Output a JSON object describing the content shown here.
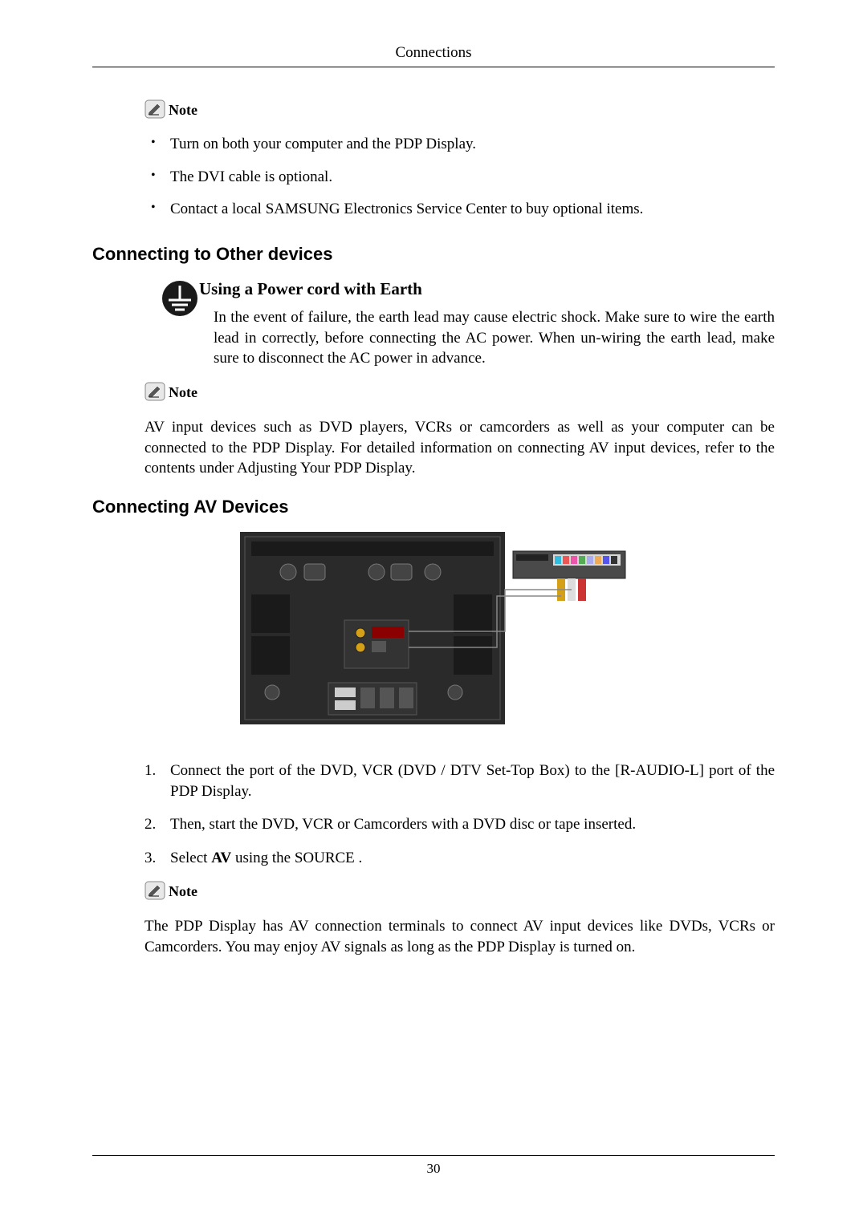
{
  "header": "Connections",
  "note_label": "Note",
  "bullets_1": [
    "Turn on both your computer and the PDP Display.",
    "The DVI cable is optional.",
    "Contact a local SAMSUNG Electronics Service Center to buy optional items."
  ],
  "heading_other": "Connecting to Other devices",
  "earth": {
    "heading": "Using a Power cord with Earth",
    "body": "In the event of failure, the earth lead may cause electric shock. Make sure to wire the earth lead in correctly, before connecting the AC power. When un-wiring the earth lead, make sure to disconnect the AC power in advance."
  },
  "body_av_note": "AV input devices such as DVD players, VCRs or camcorders as well as your computer can be connected to the PDP Display. For detailed information on connecting AV input devices, refer to the contents under Adjusting Your PDP Display.",
  "heading_av": "Connecting AV Devices",
  "steps": {
    "s1": "Connect the port of the DVD, VCR (DVD / DTV Set-Top Box) to the [R-AUDIO-L] port of the PDP Display.",
    "s2": "Then, start the DVD, VCR or Camcorders with a DVD disc or tape inserted.",
    "s3_pre": "Select ",
    "s3_bold": "AV",
    "s3_post": " using the SOURCE ."
  },
  "body_final": "The PDP Display has AV connection terminals to connect AV input devices like DVDs, VCRs or Camcorders. You may enjoy AV signals as long as the PDP Display is turned on.",
  "page_number": "30"
}
